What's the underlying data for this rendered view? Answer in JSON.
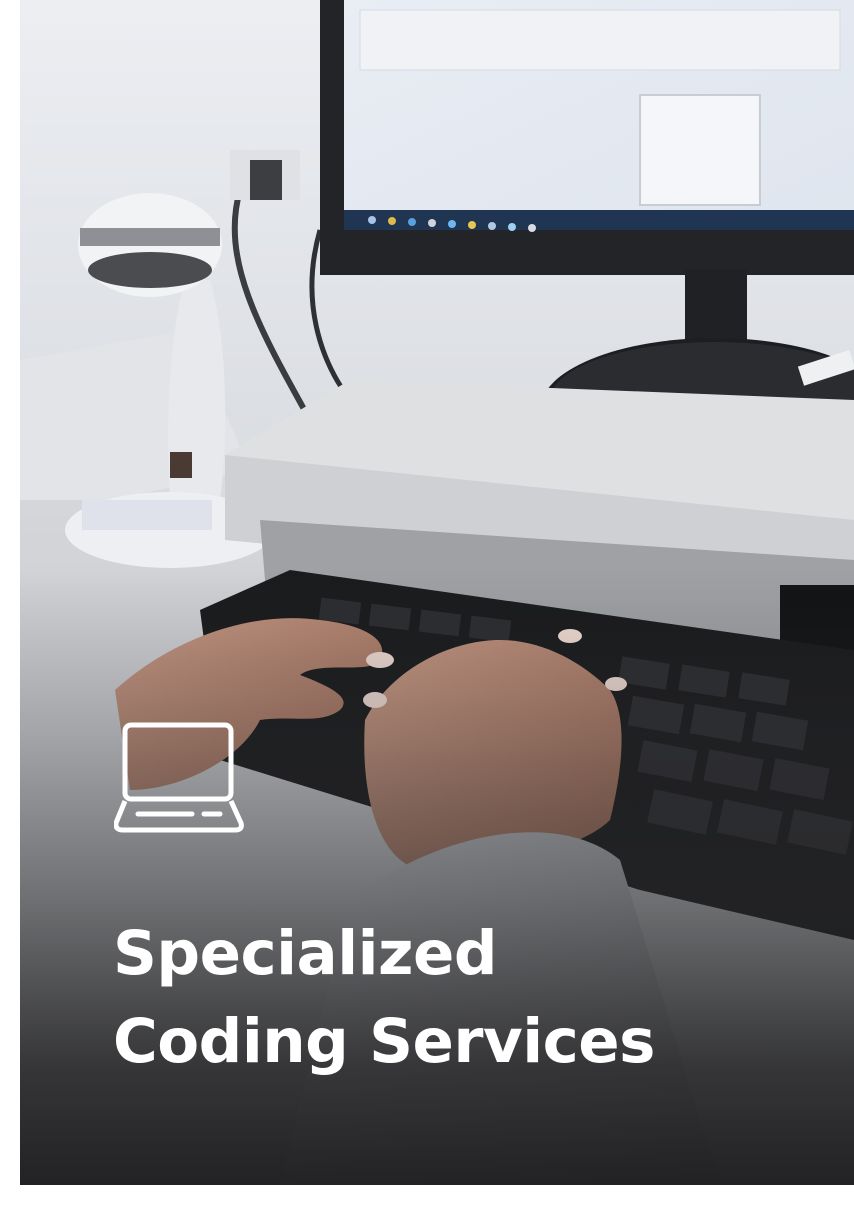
{
  "card": {
    "icon": "laptop-icon",
    "title_lines": [
      "Specialized",
      "Coding Services"
    ]
  },
  "colors": {
    "title_text": "#ffffff",
    "icon_stroke": "#ffffff",
    "overlay_dark": "#1c1c1e"
  }
}
